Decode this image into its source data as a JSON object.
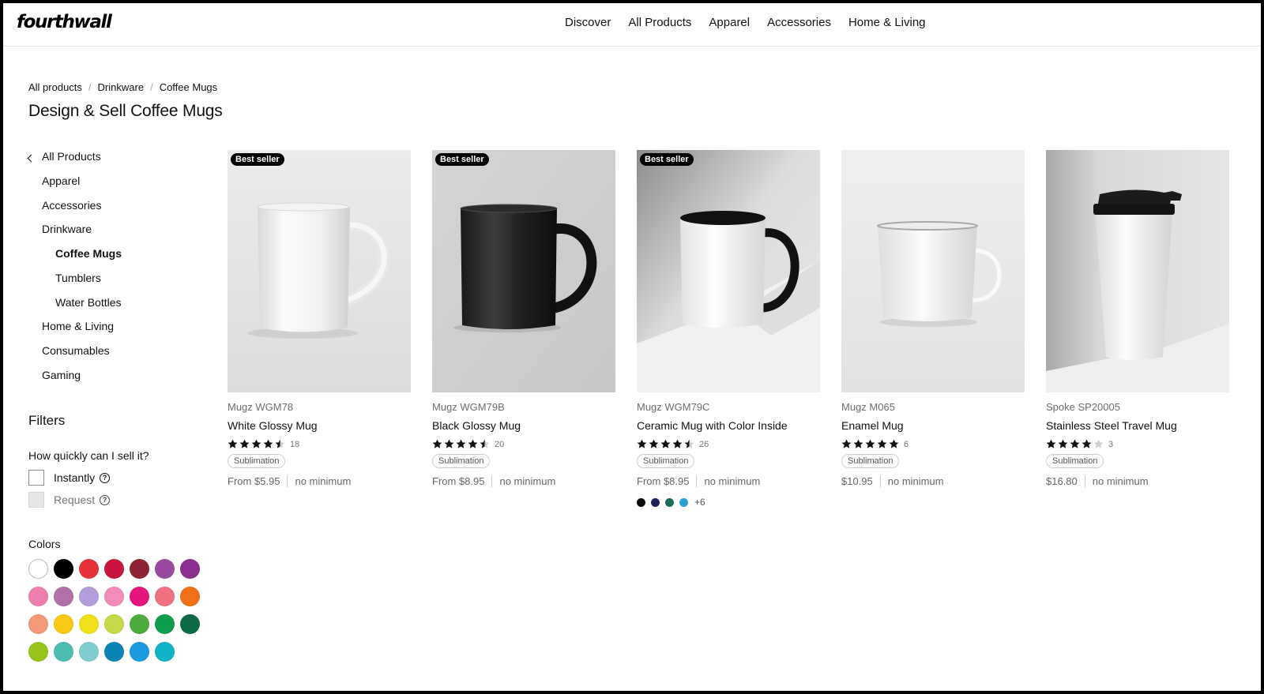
{
  "header": {
    "logo": "fourthwall",
    "nav": [
      "Discover",
      "All Products",
      "Apparel",
      "Accessories",
      "Home & Living"
    ]
  },
  "breadcrumb": [
    "All products",
    "Drinkware",
    "Coffee Mugs"
  ],
  "page_title": "Design & Sell Coffee Mugs",
  "sidebar": {
    "back_label": "All Products",
    "categories": [
      "Apparel",
      "Accessories",
      "Drinkware"
    ],
    "subcategories": [
      "Coffee Mugs",
      "Tumblers",
      "Water Bottles"
    ],
    "more_categories": [
      "Home & Living",
      "Consumables",
      "Gaming"
    ],
    "active": "Coffee Mugs"
  },
  "filters": {
    "title": "Filters",
    "sell_question": "How quickly can I sell it?",
    "options": [
      {
        "label": "Instantly",
        "checked": false,
        "enabled": true
      },
      {
        "label": "Request",
        "checked": false,
        "enabled": false
      }
    ],
    "colors_title": "Colors",
    "colors": [
      "#ffffff",
      "#000000",
      "#e53238",
      "#c8163f",
      "#8e2234",
      "#9a4a9e",
      "#8c2e8f",
      "#ef7fae",
      "#b270aa",
      "#b39ddb",
      "#f28cbb",
      "#e6147f",
      "#ef7180",
      "#ef7016",
      "#f39a79",
      "#f8c916",
      "#f0e01a",
      "#c8d84b",
      "#4cad3e",
      "#0e9d4a",
      "#0c6b45",
      "#98c51c",
      "#4ebcb0",
      "#7fcdd0",
      "#0984b4",
      "#1a9ae0",
      "#10b4c6"
    ]
  },
  "products": [
    {
      "badge": "Best seller",
      "brand": "Mugz WGM78",
      "name": "White Glossy Mug",
      "rating": 4.5,
      "reviews": "18",
      "tag": "Sublimation",
      "price": "From $5.95",
      "minimum": "no minimum",
      "mug": "white"
    },
    {
      "badge": "Best seller",
      "brand": "Mugz WGM79B",
      "name": "Black Glossy Mug",
      "rating": 4.5,
      "reviews": "20",
      "tag": "Sublimation",
      "price": "From $8.95",
      "minimum": "no minimum",
      "mug": "black"
    },
    {
      "badge": "Best seller",
      "brand": "Mugz WGM79C",
      "name": "Ceramic Mug with Color Inside",
      "rating": 4.5,
      "reviews": "26",
      "tag": "Sublimation",
      "price": "From $8.95",
      "minimum": "no minimum",
      "mug": "color-inside",
      "color_dots": [
        "#0b0b0b",
        "#1b2258",
        "#1c6a5a",
        "#2aa0d2"
      ],
      "more_colors": "+6"
    },
    {
      "badge": "",
      "brand": "Mugz M065",
      "name": "Enamel Mug",
      "rating": 5,
      "reviews": "6",
      "tag": "Sublimation",
      "price": "$10.95",
      "minimum": "no minimum",
      "mug": "enamel"
    },
    {
      "badge": "",
      "brand": "Spoke SP20005",
      "name": "Stainless Steel Travel Mug",
      "rating": 4,
      "reviews": "3",
      "tag": "Sublimation",
      "price": "$16.80",
      "minimum": "no minimum",
      "mug": "travel"
    }
  ]
}
